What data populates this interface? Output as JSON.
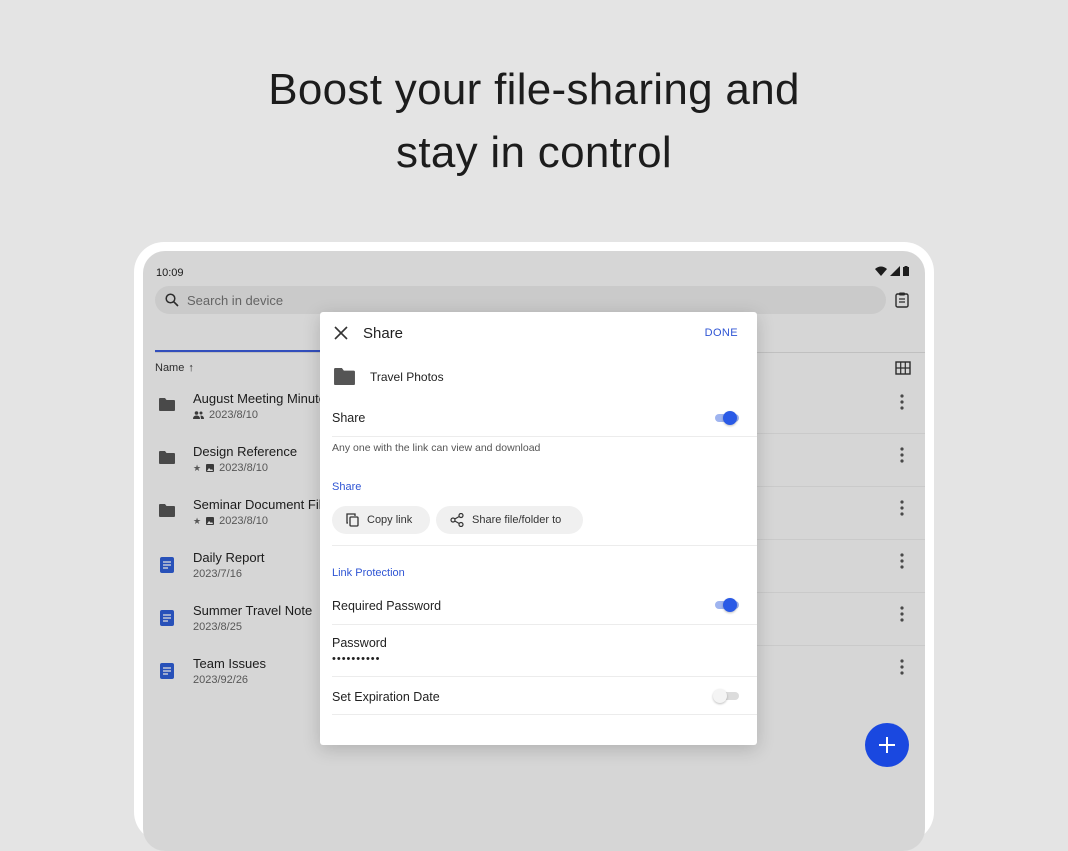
{
  "headline": {
    "line1": "Boost your file-sharing and",
    "line2": "stay in control"
  },
  "status_bar": {
    "time": "10:09"
  },
  "search": {
    "placeholder": "Search in device"
  },
  "list_header": {
    "sort_label": "Name",
    "sort_arrow": "↑"
  },
  "files": [
    {
      "name": "August Meeting Minutes",
      "meta": "2023/8/10",
      "type": "folder",
      "badges": [
        "shared-people-icon"
      ]
    },
    {
      "name": "Design Reference",
      "meta": "2023/8/10",
      "type": "folder",
      "badges": [
        "star-icon",
        "image-icon"
      ]
    },
    {
      "name": "Seminar Document Files",
      "meta": "2023/8/10",
      "type": "folder",
      "badges": [
        "star-icon",
        "image-icon"
      ]
    },
    {
      "name": "Daily Report",
      "meta": "2023/7/16",
      "type": "document",
      "badges": []
    },
    {
      "name": "Summer Travel Note",
      "meta": "2023/8/25",
      "type": "document",
      "badges": []
    },
    {
      "name": "Team Issues",
      "meta": "2023/92/26",
      "type": "document",
      "badges": []
    }
  ],
  "dialog": {
    "title": "Share",
    "done_label": "DONE",
    "folder_name": "Travel Photos",
    "share_label": "Share",
    "share_enabled": true,
    "share_hint": "Any one with the link can view and download",
    "share_section": "Share",
    "copy_link_label": "Copy link",
    "share_to_label": "Share file/folder to",
    "protection_section": "Link Protection",
    "required_password_label": "Required Password",
    "required_password_enabled": true,
    "password_label": "Password",
    "password_value": "••••••••••",
    "expiration_label": "Set Expiration Date",
    "expiration_enabled": false
  },
  "colors": {
    "accent": "#2a5ae6",
    "fab": "#1a48e0",
    "background": "#e4e4e4"
  },
  "icons": [
    "search-icon",
    "clipboard-icon",
    "grid-view-icon",
    "folder-icon",
    "document-icon",
    "more-vert-icon",
    "close-icon",
    "copy-icon",
    "share-icon",
    "add-icon",
    "wifi-icon",
    "signal-icon",
    "battery-icon"
  ]
}
